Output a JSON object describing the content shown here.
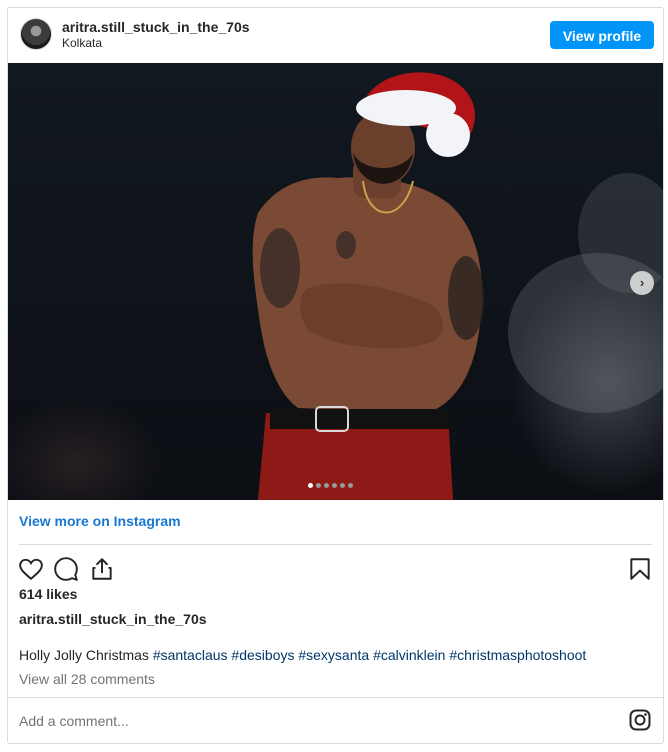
{
  "header": {
    "username": "aritra.still_stuck_in_the_70s",
    "location": "Kolkata",
    "view_profile_label": "View profile"
  },
  "photo": {
    "carousel_dots": 6,
    "active_dot": 1
  },
  "links": {
    "view_more": "View more on Instagram"
  },
  "icons": {
    "like": "heart-icon",
    "comment": "comment-icon",
    "share": "share-icon",
    "save": "bookmark-icon",
    "next": "chevron-right-icon",
    "instagram": "instagram-icon"
  },
  "post": {
    "likes": "614 likes",
    "caption_user": "aritra.still_stuck_in_the_70s",
    "caption_text": "Holly Jolly Christmas ",
    "hashtags": [
      "#santaclaus",
      "#desiboys",
      "#sexysanta",
      "#calvinklein",
      "#christmasphotoshoot"
    ],
    "view_comments": "View all 28 comments"
  },
  "comment_box": {
    "placeholder": "Add a comment..."
  },
  "colors": {
    "accent": "#0095f6",
    "link": "#1877d2",
    "hashtag": "#00376b",
    "muted": "#737373",
    "border": "#dbdbdb"
  }
}
